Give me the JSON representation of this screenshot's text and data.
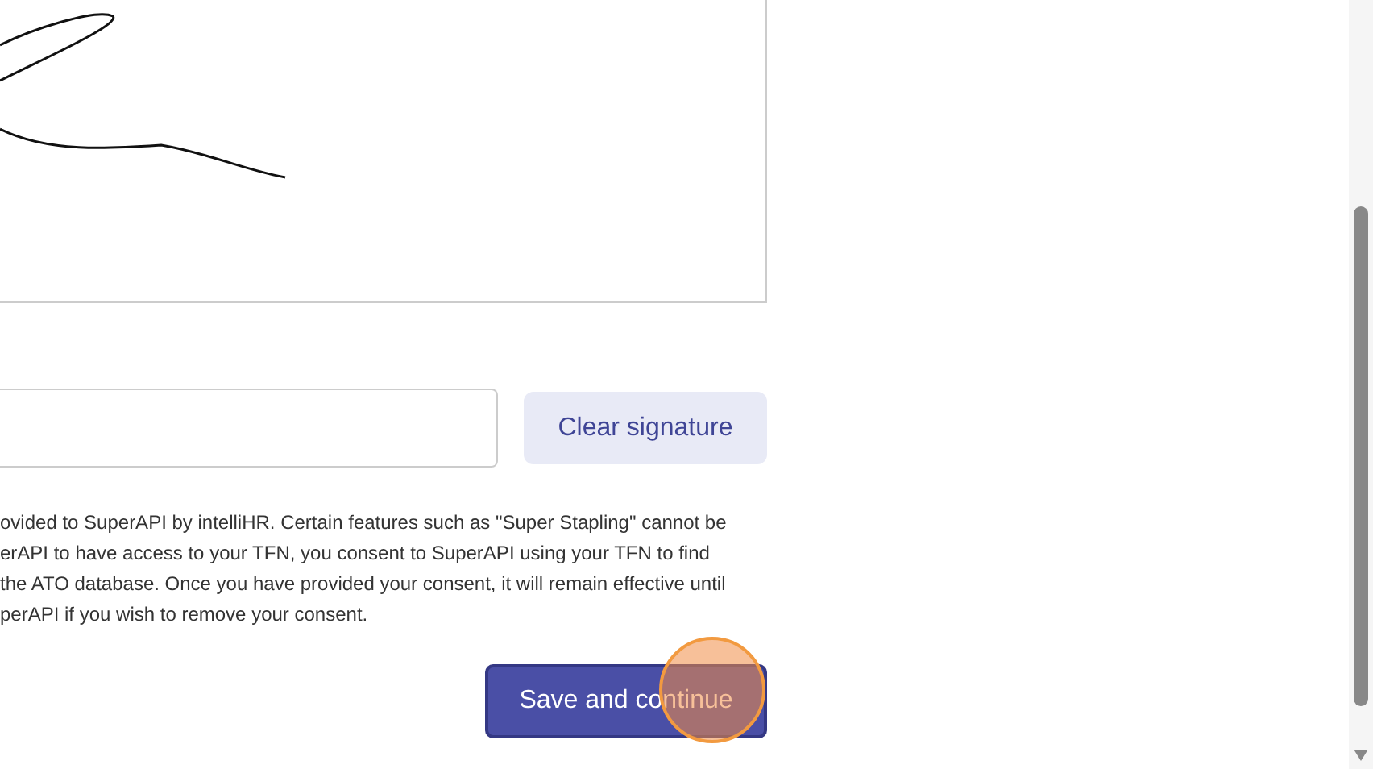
{
  "signature_actions": {
    "clear_button": "Clear signature"
  },
  "consent_text": [
    "ovided to SuperAPI by intelliHR. Certain features such as \"Super Stapling\" cannot be",
    "erAPI to have access to your TFN, you consent to SuperAPI using your TFN to find",
    "the ATO database. Once you have provided your consent, it will remain effective until",
    "perAPI if you wish to remove your consent."
  ],
  "primary_button": "Save and continue"
}
